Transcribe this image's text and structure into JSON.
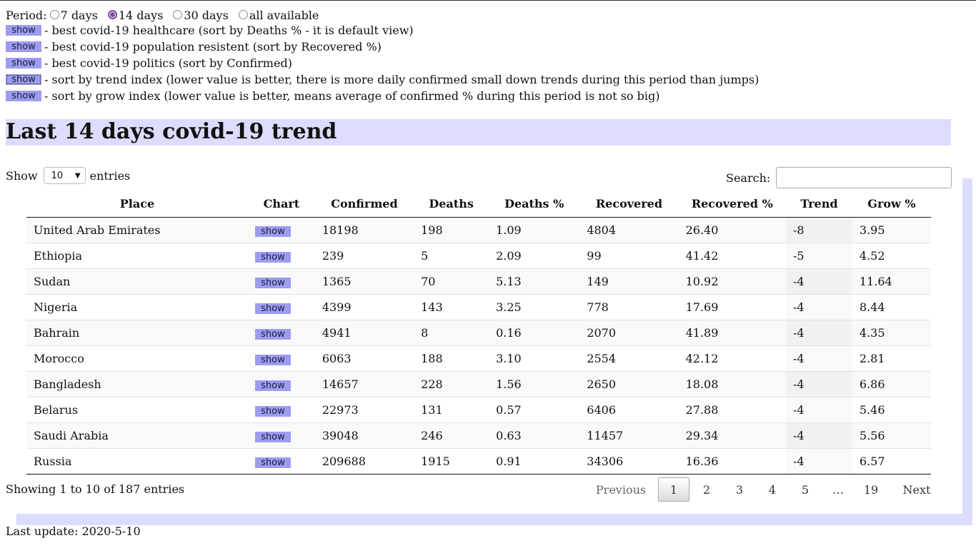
{
  "period": {
    "label": "Period:",
    "options": [
      "7 days",
      "14 days",
      "30 days",
      "all available"
    ],
    "selected": "14 days"
  },
  "show_label": "show",
  "sort_options": [
    "- best covid-19 healthcare (sort by Deaths % - it is default view)",
    "- best covid-19 population resistent (sort by Recovered %)",
    "- best covid-19 politics (sort by Confirmed)",
    "- sort by trend index (lower value is better, there is more daily confirmed small down trends during this period than jumps)",
    "- sort by grow index (lower value is better, means average of confirmed % during this period is not so big)"
  ],
  "heading": "Last 14 days covid-19 trend",
  "length": {
    "prefix": "Show",
    "value": "10",
    "suffix": "entries"
  },
  "search": {
    "label": "Search:",
    "value": ""
  },
  "table": {
    "columns": [
      "Place",
      "Chart",
      "Confirmed",
      "Deaths",
      "Deaths %",
      "Recovered",
      "Recovered %",
      "Trend",
      "Grow %"
    ],
    "rows": [
      {
        "place": "United Arab Emirates",
        "chart": "show",
        "confirmed": "18198",
        "deaths": "198",
        "deaths_pct": "1.09",
        "recovered": "4804",
        "recovered_pct": "26.40",
        "trend": "-8",
        "grow_pct": "3.95"
      },
      {
        "place": "Ethiopia",
        "chart": "show",
        "confirmed": "239",
        "deaths": "5",
        "deaths_pct": "2.09",
        "recovered": "99",
        "recovered_pct": "41.42",
        "trend": "-5",
        "grow_pct": "4.52"
      },
      {
        "place": "Sudan",
        "chart": "show",
        "confirmed": "1365",
        "deaths": "70",
        "deaths_pct": "5.13",
        "recovered": "149",
        "recovered_pct": "10.92",
        "trend": "-4",
        "grow_pct": "11.64"
      },
      {
        "place": "Nigeria",
        "chart": "show",
        "confirmed": "4399",
        "deaths": "143",
        "deaths_pct": "3.25",
        "recovered": "778",
        "recovered_pct": "17.69",
        "trend": "-4",
        "grow_pct": "8.44"
      },
      {
        "place": "Bahrain",
        "chart": "show",
        "confirmed": "4941",
        "deaths": "8",
        "deaths_pct": "0.16",
        "recovered": "2070",
        "recovered_pct": "41.89",
        "trend": "-4",
        "grow_pct": "4.35"
      },
      {
        "place": "Morocco",
        "chart": "show",
        "confirmed": "6063",
        "deaths": "188",
        "deaths_pct": "3.10",
        "recovered": "2554",
        "recovered_pct": "42.12",
        "trend": "-4",
        "grow_pct": "2.81"
      },
      {
        "place": "Bangladesh",
        "chart": "show",
        "confirmed": "14657",
        "deaths": "228",
        "deaths_pct": "1.56",
        "recovered": "2650",
        "recovered_pct": "18.08",
        "trend": "-4",
        "grow_pct": "6.86"
      },
      {
        "place": "Belarus",
        "chart": "show",
        "confirmed": "22973",
        "deaths": "131",
        "deaths_pct": "0.57",
        "recovered": "6406",
        "recovered_pct": "27.88",
        "trend": "-4",
        "grow_pct": "5.46"
      },
      {
        "place": "Saudi Arabia",
        "chart": "show",
        "confirmed": "39048",
        "deaths": "246",
        "deaths_pct": "0.63",
        "recovered": "11457",
        "recovered_pct": "29.34",
        "trend": "-4",
        "grow_pct": "5.56"
      },
      {
        "place": "Russia",
        "chart": "show",
        "confirmed": "209688",
        "deaths": "1915",
        "deaths_pct": "0.91",
        "recovered": "34306",
        "recovered_pct": "16.36",
        "trend": "-4",
        "grow_pct": "6.57"
      }
    ]
  },
  "info": "Showing 1 to 10 of 187 entries",
  "pagination": {
    "previous": "Previous",
    "pages": [
      "1",
      "2",
      "3",
      "4",
      "5"
    ],
    "current": "1",
    "ellipsis": "…",
    "last": "19",
    "next": "Next"
  },
  "last_update": "Last update: 2020-5-10",
  "colors": {
    "accent_button": "#9c9cf0",
    "heading_band": "#dcdcff",
    "radio_checked": "#7a4a9c"
  }
}
